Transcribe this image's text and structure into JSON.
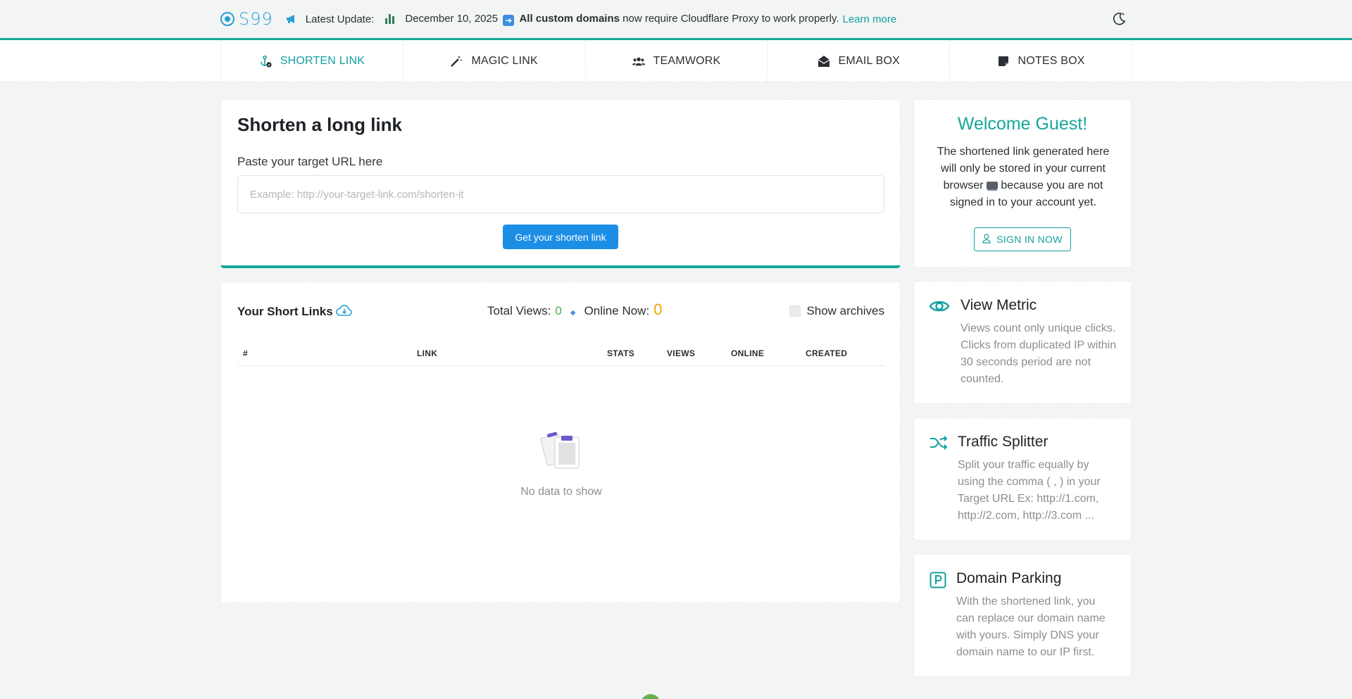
{
  "topbar": {
    "logo_text": "S99",
    "latest_update_label": "Latest Update:",
    "update_date": "December 10, 2025",
    "update_bold": "All custom domains",
    "update_rest": "now require Cloudflare Proxy to work properly.",
    "learn_more": "Learn more",
    "icons": [
      "logo-icon",
      "megaphone-icon",
      "bar-chart-icon",
      "arrow-right-emoji",
      "moon-icon"
    ]
  },
  "nav": {
    "tabs": [
      {
        "label": "SHORTEN LINK",
        "icon": "anchor-icon",
        "active": true
      },
      {
        "label": "MAGIC LINK",
        "icon": "magic-wand-icon",
        "active": false
      },
      {
        "label": "TEAMWORK",
        "icon": "users-icon",
        "active": false
      },
      {
        "label": "EMAIL BOX",
        "icon": "envelope-open-icon",
        "active": false
      },
      {
        "label": "NOTES BOX",
        "icon": "sticky-note-icon",
        "active": false
      }
    ]
  },
  "shorten": {
    "title": "Shorten a long link",
    "input_label": "Paste your target URL here",
    "input_placeholder": "Example: http://your-target-link.com/shorten-it",
    "input_value": "",
    "button": "Get your shorten link"
  },
  "links": {
    "title": "Your Short Links",
    "total_views_label": "Total Views:",
    "total_views": "0",
    "online_now_label": "Online Now:",
    "online_now": "0",
    "show_archives": "Show archives",
    "columns": [
      "#",
      "LINK",
      "STATS",
      "VIEWS",
      "ONLINE",
      "CREATED"
    ],
    "rows": [],
    "empty_text": "No data to show"
  },
  "welcome": {
    "title": "Welcome Guest!",
    "text_before": "The shortened link generated here will only be stored in your current browser",
    "text_after": "because you are not signed in to your account yet.",
    "signin_button": "SIGN IN NOW"
  },
  "features": {
    "metric": {
      "title": "View Metric",
      "text": "Views count only unique clicks. Clicks from duplicated IP within 30 seconds period are not counted."
    },
    "splitter": {
      "title": "Traffic Splitter",
      "text": "Split your traffic equally by using the comma ( , ) in your Target URL Ex: http://1.com, http://2.com, http://3.com ..."
    },
    "parking": {
      "title": "Domain Parking",
      "text": "With the shortened link, you can replace our domain name with yours. Simply DNS your domain name to our IP first."
    }
  },
  "colors": {
    "accent": "#14a89a",
    "primary_button": "#1d8ee6",
    "link": "#14a0a0",
    "views_green": "#4caf50",
    "online_orange": "#f0a500"
  }
}
